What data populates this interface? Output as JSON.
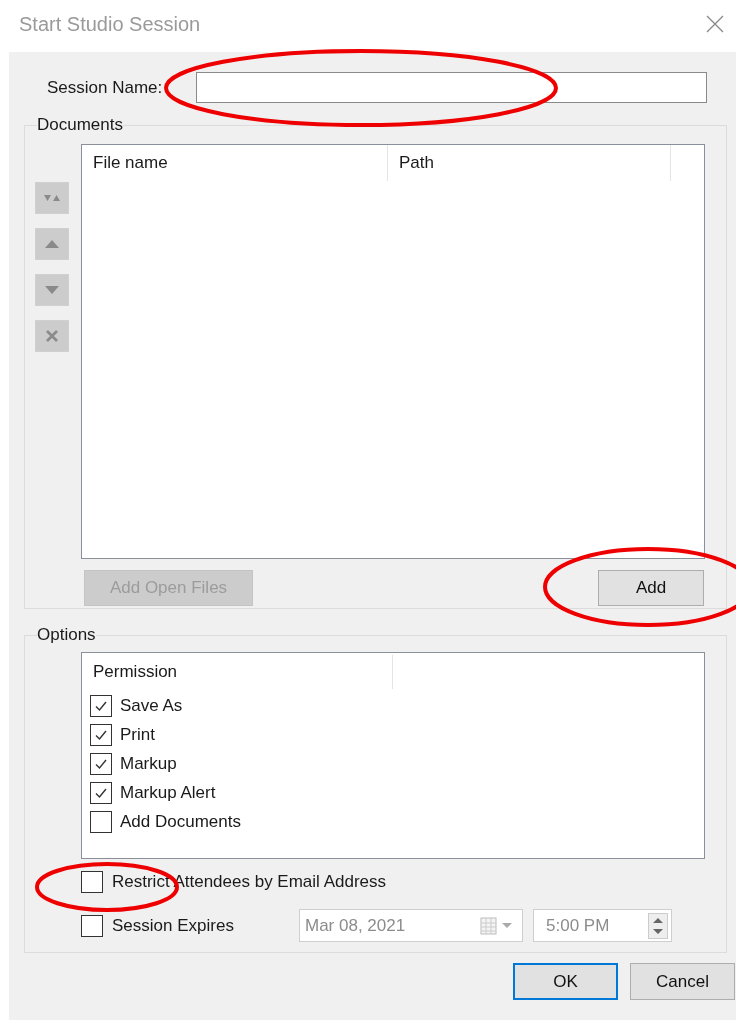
{
  "window": {
    "title": "Start Studio Session"
  },
  "session_name": {
    "label": "Session Name:"
  },
  "documents": {
    "title": "Documents",
    "columns": [
      "File name",
      "Path"
    ],
    "buttons": [
      {
        "label": "Add Open Files",
        "disabled": true
      },
      {
        "label": "Add",
        "disabled": false
      }
    ]
  },
  "options": {
    "title": "Options",
    "column": "Permission",
    "permissions": [
      {
        "label": "Save As",
        "checked": true
      },
      {
        "label": "Print",
        "checked": true
      },
      {
        "label": "Markup",
        "checked": true
      },
      {
        "label": "Markup Alert",
        "checked": true
      },
      {
        "label": "Add Documents",
        "checked": false
      }
    ],
    "restrict": {
      "label": "Restrict Attendees by Email Address",
      "checked": false
    },
    "expires": {
      "label": "Session Expires",
      "checked": false,
      "date": "Mar 08, 2021",
      "time": "5:00 PM",
      "disabled": true
    }
  },
  "buttons": [
    {
      "label": "OK",
      "default": true
    },
    {
      "label": "Cancel",
      "default": false
    }
  ]
}
